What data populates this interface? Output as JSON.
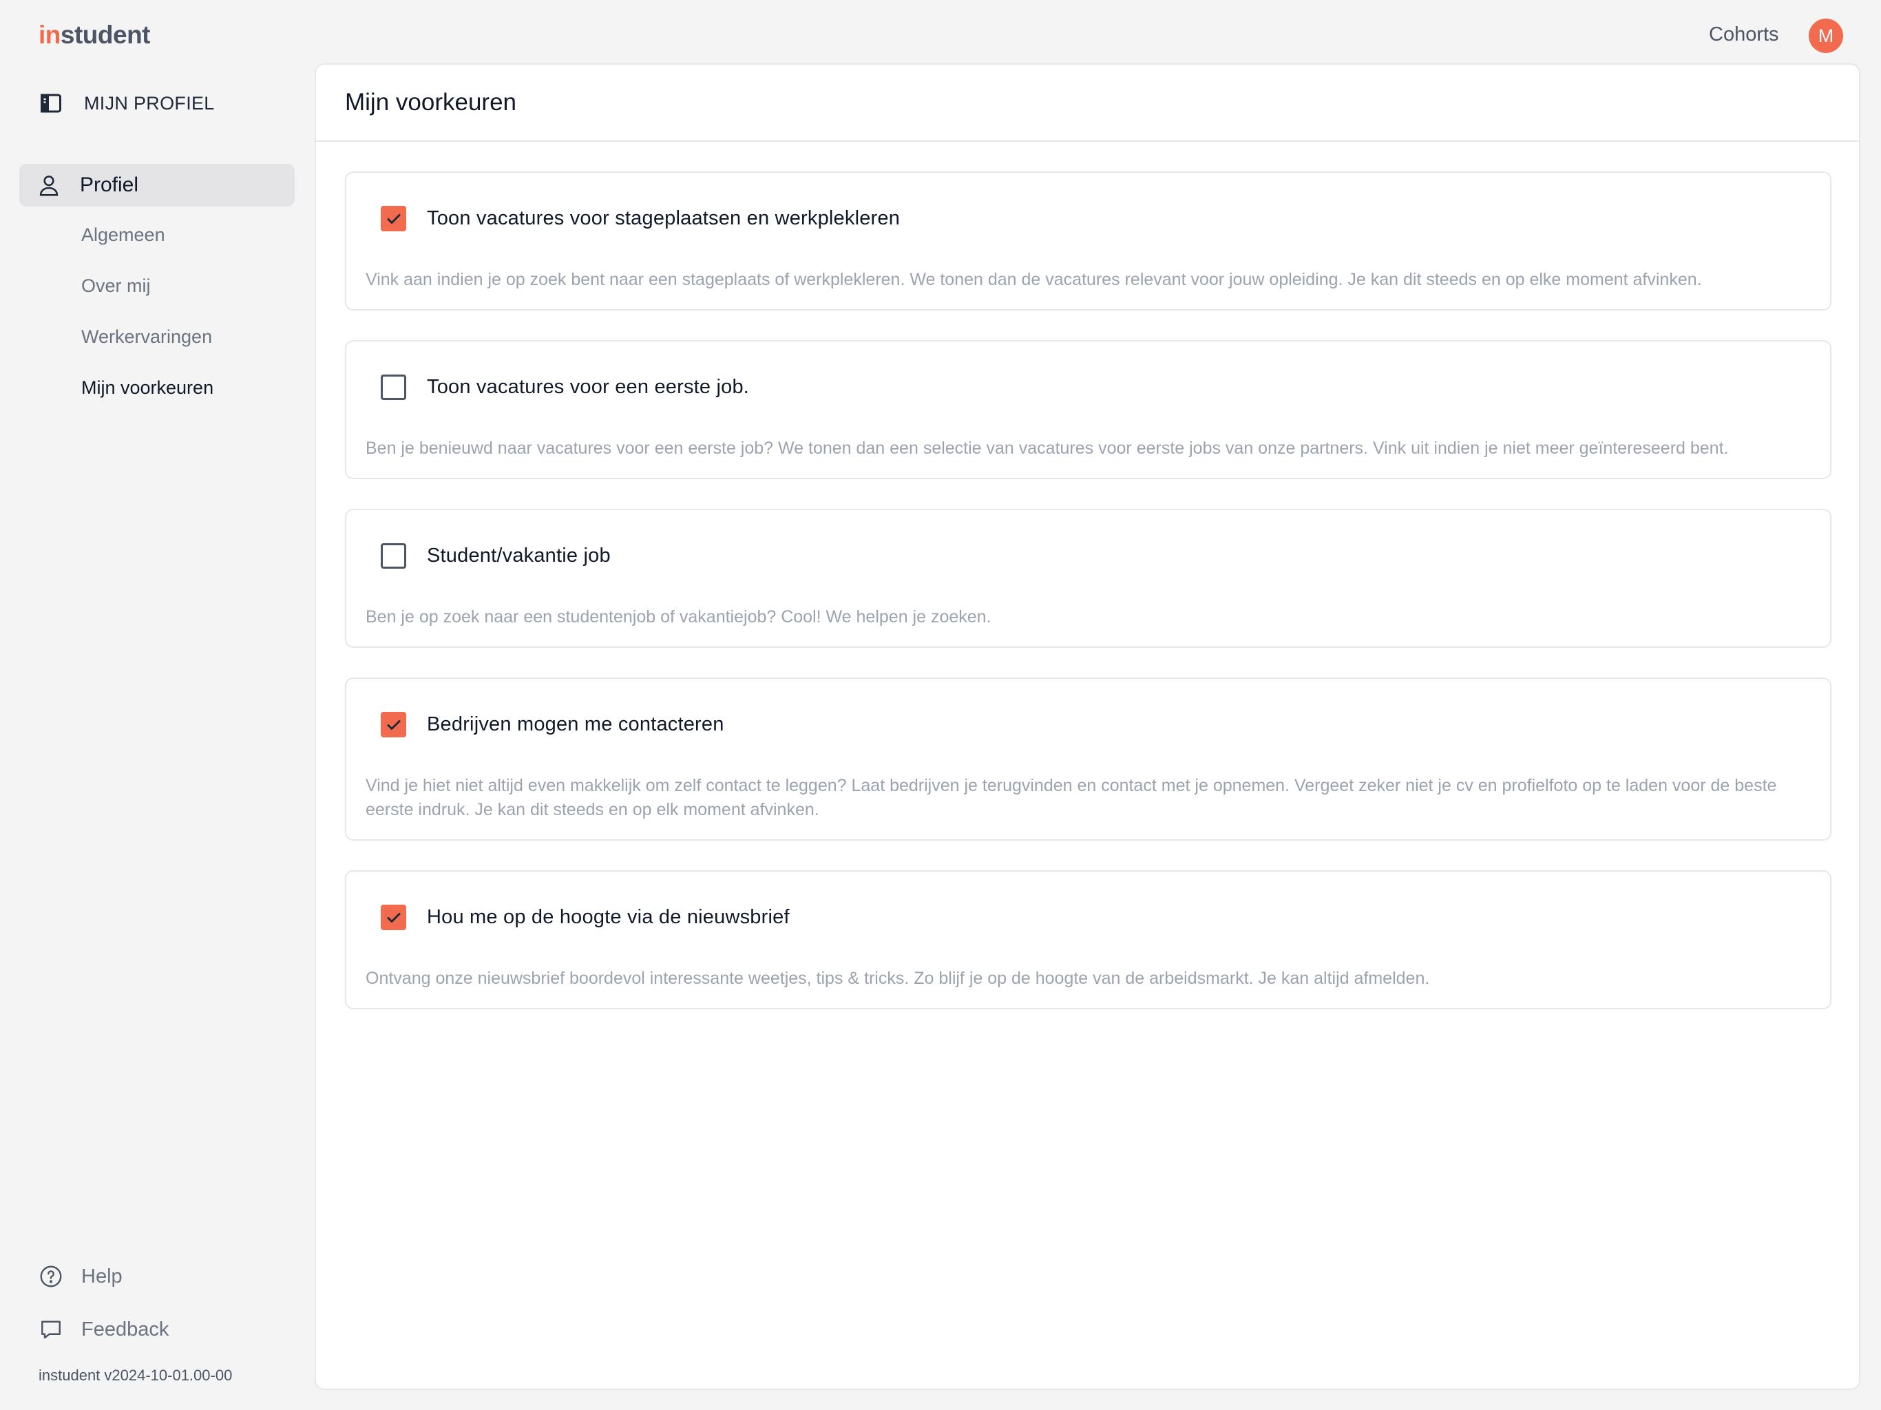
{
  "topbar": {
    "logo_accent": "in",
    "logo_rest": "student",
    "cohorts_label": "Cohorts",
    "avatar_initial": "M"
  },
  "sidebar": {
    "section_title": "MIJN PROFIEL",
    "profile_label": "Profiel",
    "subitems": [
      "Algemeen",
      "Over mij",
      "Werkervaringen",
      "Mijn voorkeuren"
    ],
    "help_label": "Help",
    "feedback_label": "Feedback",
    "version": "instudent v2024-10-01.00-00"
  },
  "main": {
    "title": "Mijn voorkeuren",
    "preferences": [
      {
        "label": "Toon vacatures voor stageplaatsen en werkplekleren",
        "checked": true,
        "description": "Vink aan indien je op zoek bent naar een stageplaats of werkplekleren. We tonen dan de vacatures relevant voor jouw opleiding. Je kan dit steeds en op elke moment afvinken."
      },
      {
        "label": "Toon vacatures voor een eerste job.",
        "checked": false,
        "description": "Ben je benieuwd naar vacatures voor een eerste job? We tonen dan een selectie van vacatures voor eerste jobs van onze partners. Vink uit indien je niet meer geïntereseerd bent."
      },
      {
        "label": "Student/vakantie job",
        "checked": false,
        "description": "Ben je op zoek naar een studentenjob of vakantiejob? Cool! We helpen je zoeken."
      },
      {
        "label": "Bedrijven mogen me contacteren",
        "checked": true,
        "description": "Vind je hiet niet altijd even makkelijk om zelf contact te leggen? Laat bedrijven je terugvinden en contact met je opnemen. Vergeet zeker niet je cv en profielfoto op te laden voor de beste eerste indruk. Je kan dit steeds en op elk moment afvinken."
      },
      {
        "label": "Hou me op de hoogte via de nieuwsbrief",
        "checked": true,
        "description": "Ontvang onze nieuwsbrief boordevol interessante weetjes, tips & tricks. Zo blijf je op de hoogte van de arbeidsmarkt. Je kan altijd afmelden."
      }
    ]
  },
  "colors": {
    "accent": "#f26b4f",
    "background": "#f4f4f5",
    "muted_text": "#9ca3af"
  }
}
